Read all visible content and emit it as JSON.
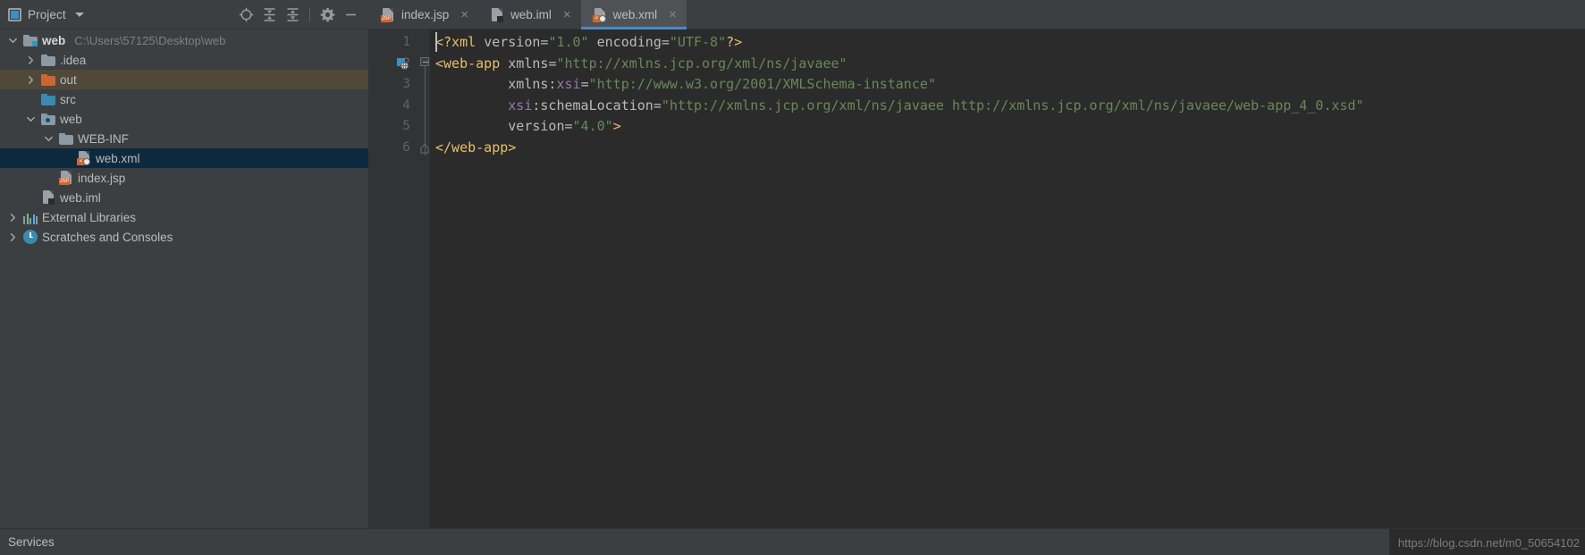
{
  "project_panel": {
    "title": "Project",
    "title_icon": "project-window-icon",
    "dropdown_icon": "chevron-down-icon",
    "tools": [
      {
        "name": "locate-icon",
        "label": "Select Opened File"
      },
      {
        "name": "expand-all-icon",
        "label": "Expand All"
      },
      {
        "name": "collapse-all-icon",
        "label": "Collapse All"
      },
      {
        "name": "gear-icon",
        "label": "Settings"
      },
      {
        "name": "minimize-icon",
        "label": "Hide"
      }
    ],
    "tree": [
      {
        "label": "web",
        "path": "C:\\Users\\57125\\Desktop\\web",
        "icon": "module-folder-icon",
        "arrow": "expanded",
        "indent": 0,
        "bold": true,
        "state": "normal"
      },
      {
        "label": ".idea",
        "path": "",
        "icon": "folder-icon",
        "arrow": "collapsed",
        "indent": 1,
        "bold": false,
        "state": "normal"
      },
      {
        "label": "out",
        "path": "",
        "icon": "folder-orange-icon",
        "arrow": "collapsed",
        "indent": 1,
        "bold": false,
        "state": "highlighted"
      },
      {
        "label": "src",
        "path": "",
        "icon": "folder-source-icon",
        "arrow": "none",
        "indent": 1,
        "bold": false,
        "state": "normal"
      },
      {
        "label": "web",
        "path": "",
        "icon": "folder-web-icon",
        "arrow": "expanded",
        "indent": 1,
        "bold": false,
        "state": "normal"
      },
      {
        "label": "WEB-INF",
        "path": "",
        "icon": "folder-icon",
        "arrow": "expanded",
        "indent": 2,
        "bold": false,
        "state": "normal"
      },
      {
        "label": "web.xml",
        "path": "",
        "icon": "xml-file-icon",
        "arrow": "none",
        "indent": 3,
        "bold": false,
        "state": "selected"
      },
      {
        "label": "index.jsp",
        "path": "",
        "icon": "jsp-file-icon",
        "arrow": "none",
        "indent": 2,
        "bold": false,
        "state": "normal"
      },
      {
        "label": "web.iml",
        "path": "",
        "icon": "iml-file-icon",
        "arrow": "none",
        "indent": 1,
        "bold": false,
        "state": "normal"
      },
      {
        "label": "External Libraries",
        "path": "",
        "icon": "libraries-icon",
        "arrow": "collapsed",
        "indent": 0,
        "bold": false,
        "state": "normal"
      },
      {
        "label": "Scratches and Consoles",
        "path": "",
        "icon": "scratches-icon",
        "arrow": "collapsed",
        "indent": 0,
        "bold": false,
        "state": "normal"
      }
    ]
  },
  "tabs": [
    {
      "label": "index.jsp",
      "icon": "jsp-file-icon",
      "active": false,
      "close_icon": "close-icon"
    },
    {
      "label": "web.iml",
      "icon": "iml-file-icon",
      "active": false,
      "close_icon": "close-icon"
    },
    {
      "label": "web.xml",
      "icon": "xml-file-icon",
      "active": true,
      "close_icon": "close-icon"
    }
  ],
  "editor": {
    "line_numbers": [
      "1",
      "2",
      "3",
      "4",
      "5",
      "6"
    ],
    "lines": [
      [
        {
          "t": "<?xml ",
          "c": "punct"
        },
        {
          "t": "version",
          "c": "attr"
        },
        {
          "t": "=",
          "c": "eq"
        },
        {
          "t": "\"1.0\"",
          "c": "str"
        },
        {
          "t": " ",
          "c": "attr"
        },
        {
          "t": "encoding",
          "c": "attr"
        },
        {
          "t": "=",
          "c": "eq"
        },
        {
          "t": "\"UTF-8\"",
          "c": "str"
        },
        {
          "t": "?>",
          "c": "punct"
        }
      ],
      [
        {
          "t": "<web-app",
          "c": "tagname"
        },
        {
          "t": " ",
          "c": "attr"
        },
        {
          "t": "xmlns",
          "c": "attr"
        },
        {
          "t": "=",
          "c": "eq"
        },
        {
          "t": "\"http://xmlns.jcp.org/xml/ns/javaee\"",
          "c": "str"
        }
      ],
      [
        {
          "t": "         ",
          "c": "attr"
        },
        {
          "t": "xmlns:",
          "c": "attr"
        },
        {
          "t": "xsi",
          "c": "ns"
        },
        {
          "t": "=",
          "c": "eq"
        },
        {
          "t": "\"http://www.w3.org/2001/XMLSchema-instance\"",
          "c": "str"
        }
      ],
      [
        {
          "t": "         ",
          "c": "attr"
        },
        {
          "t": "xsi",
          "c": "ns"
        },
        {
          "t": ":schemaLocation",
          "c": "attr"
        },
        {
          "t": "=",
          "c": "eq"
        },
        {
          "t": "\"http://xmlns.jcp.org/xml/ns/javaee http://xmlns.jcp.org/xml/ns/javaee/web-app_4_0.xsd\"",
          "c": "str"
        }
      ],
      [
        {
          "t": "         ",
          "c": "attr"
        },
        {
          "t": "version",
          "c": "attr"
        },
        {
          "t": "=",
          "c": "eq"
        },
        {
          "t": "\"4.0\"",
          "c": "str"
        },
        {
          "t": ">",
          "c": "punct"
        }
      ],
      [
        {
          "t": "</web-app>",
          "c": "tagname"
        }
      ]
    ],
    "gutter_icons": [
      {
        "line": 2,
        "name": "web-facet-gutter-icon"
      }
    ]
  },
  "status_bar": {
    "services_label": "Services",
    "watermark": "https://blog.csdn.net/m0_50654102"
  },
  "colors": {
    "panel_bg": "#3c3f41",
    "editor_bg": "#2b2b2b",
    "gutter_bg": "#313335",
    "selection": "#0d293e",
    "highlight": "#50493a",
    "accent": "#4a88c7",
    "tag": "#e8bf6a",
    "string": "#6a8759",
    "namespace": "#9876aa",
    "attr": "#bababa",
    "linenum": "#606366",
    "text": "#bbbbbb"
  }
}
